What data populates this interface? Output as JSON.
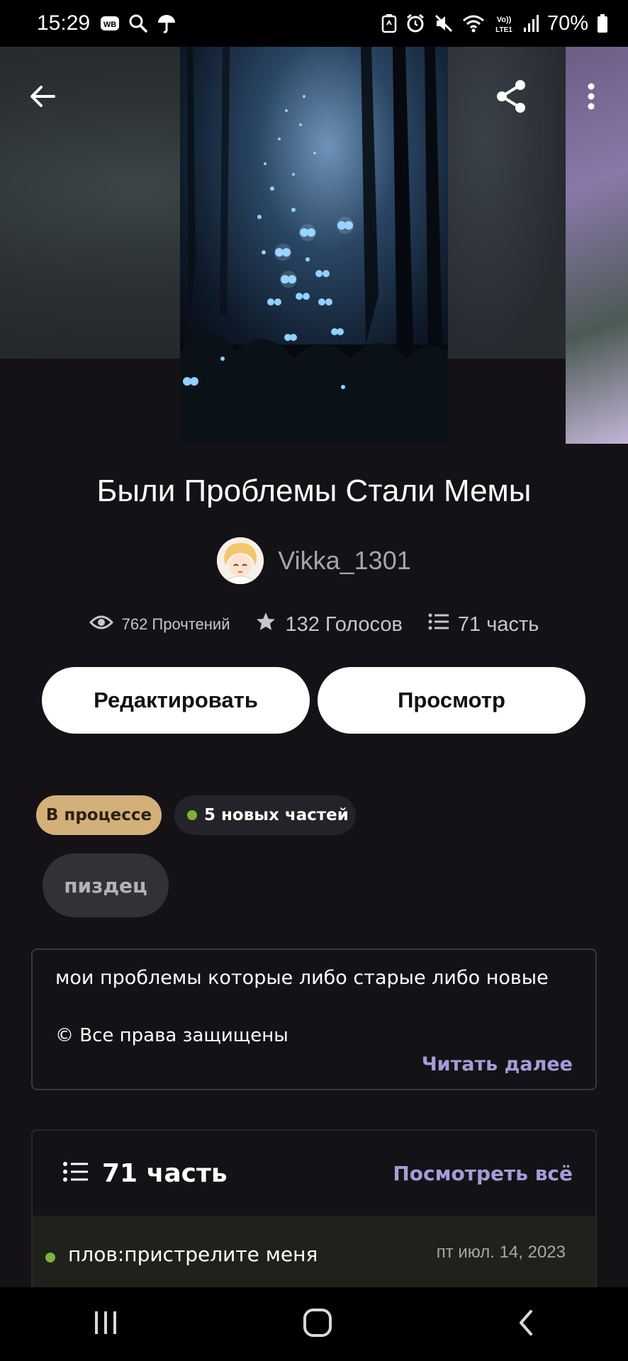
{
  "status_bar": {
    "time": "15:29",
    "battery": "70%",
    "left_icons": [
      "wb-icon",
      "search-icon",
      "umbrella-icon"
    ],
    "right_icons": [
      "battery-saver-icon",
      "alarm-icon",
      "mute-icon",
      "wifi-icon",
      "volte-icon",
      "signal-icon",
      "battery-icon"
    ],
    "volte_label": "Vo)) LTE1",
    "wb_label": "WB"
  },
  "story": {
    "title": "Были Проблемы Стали Мемы",
    "author": "Vikka_1301",
    "stats": {
      "reads": "762 Прочтений",
      "votes": "132 Голосов",
      "parts": "71 часть"
    },
    "buttons": {
      "edit": "Редактировать",
      "view": "Просмотр"
    },
    "status_chip": "В процессе",
    "new_parts_chip": "5 новых частей",
    "tag": "пиздец",
    "description": {
      "line1": "мои проблемы которые либо старые либо новые",
      "line2": "© Все права защищены",
      "read_more": "Читать далее"
    },
    "parts_section": {
      "count": "71 часть",
      "view_all": "Посмотреть всё",
      "items": [
        {
          "title": "плов:пристрелите меня",
          "date": "пт июл. 14, 2023",
          "is_new": true
        }
      ]
    }
  },
  "colors": {
    "background": "#141216",
    "accent_purple": "#a89bd8",
    "status_chip": "#d3b07a",
    "new_dot": "#7bb33b"
  }
}
